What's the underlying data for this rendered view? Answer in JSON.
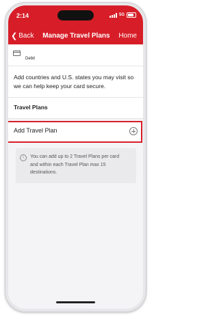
{
  "status_bar": {
    "time": "2:14",
    "network": "5G"
  },
  "nav": {
    "back_label": "Back",
    "title": "Manage Travel Plans",
    "home_label": "Home"
  },
  "card": {
    "label": "Debit"
  },
  "description": "Add countries and U.S. states you may visit so we can help keep your card secure.",
  "section_title": "Travel Plans",
  "add_plan": {
    "label": "Add Travel Plan"
  },
  "info": {
    "text": "You can add up to 2 Travel Plans per card and within each Travel Plan max 15 destinations."
  },
  "colors": {
    "brand": "#d71e28",
    "highlight_border": "#d71e28"
  }
}
